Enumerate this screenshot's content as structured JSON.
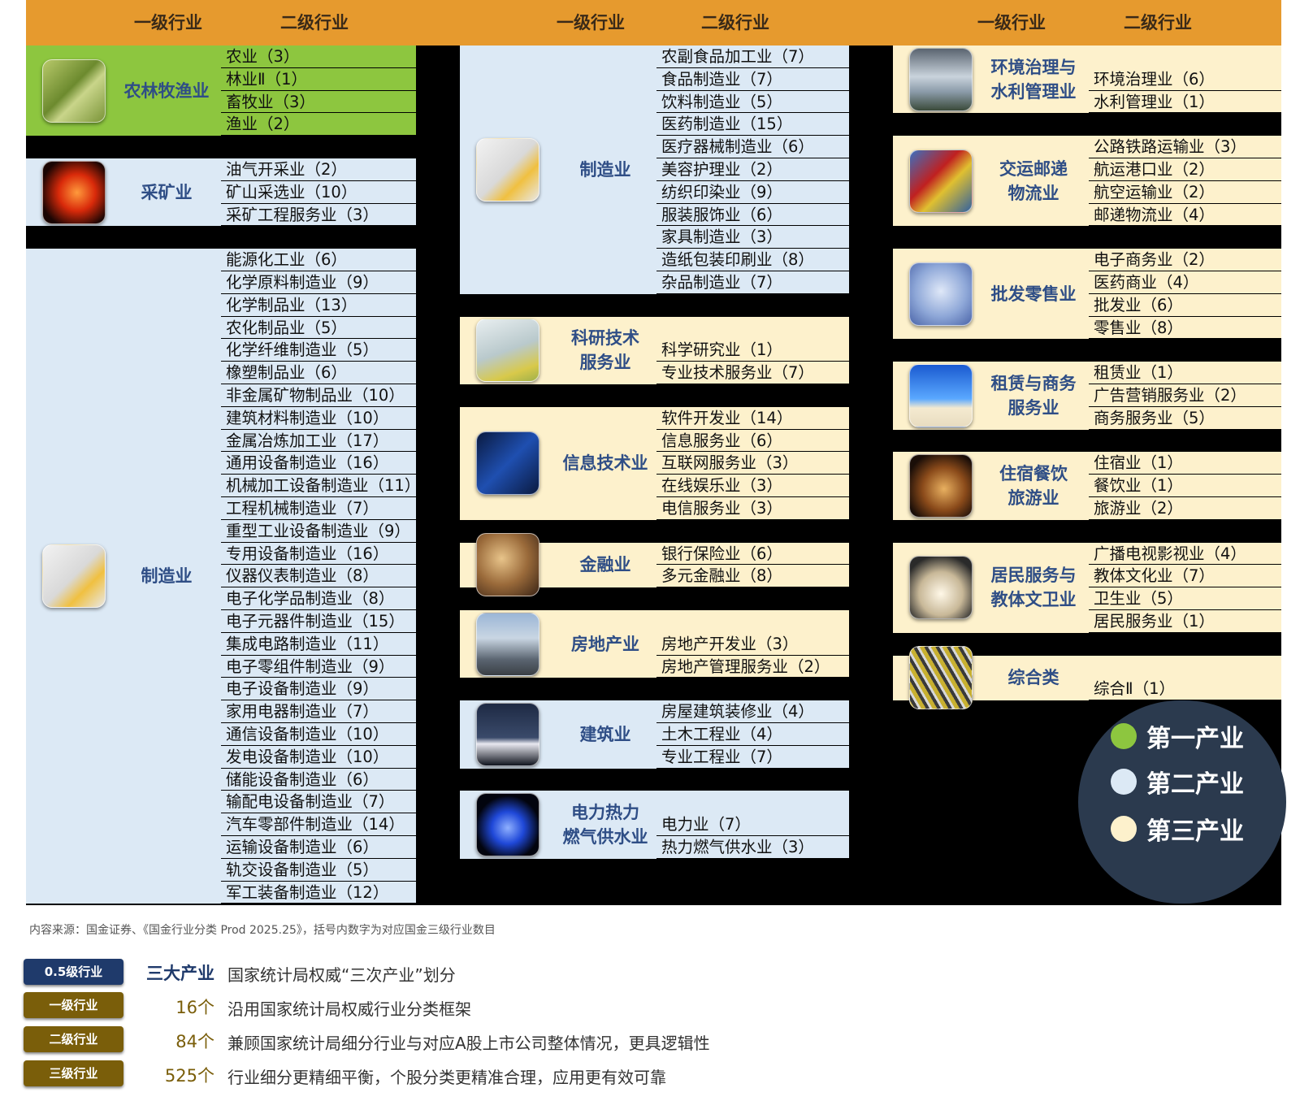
{
  "header": {
    "col1": "一级行业",
    "col2": "二级行业"
  },
  "colors": {
    "primary": "#8DC63F",
    "secondary": "#DCE9F5",
    "tertiary": "#FDF1CC",
    "header": "#E69A2E",
    "badge_navy": "#1F3A6B",
    "badge_gold": "#7A5E0A"
  },
  "columns": [
    {
      "blocks": [
        {
          "name": "农林牧渔业",
          "icon": "field-icon",
          "sector": "primary",
          "subs": [
            "农业（3）",
            "林业Ⅱ（1）",
            "畜牧业（3）",
            "渔业（2）"
          ]
        },
        {
          "name": "采矿业",
          "icon": "molten-metal-icon",
          "sector": "secondary",
          "subs": [
            "油气开采业（2）",
            "矿山采选业（10）",
            "采矿工程服务业（3）"
          ]
        },
        {
          "name": "制造业",
          "icon": "robot-arm-icon",
          "sector": "secondary",
          "subs": [
            "能源化工业（6）",
            "化学原料制造业（9）",
            "化学制品业（13）",
            "农化制品业（5）",
            "化学纤维制造业（5）",
            "橡塑制品业（6）",
            "非金属矿物制品业（10）",
            "建筑材料制造业（10）",
            "金属冶炼加工业（17）",
            "通用设备制造业（16）",
            "机械加工设备制造业（11）",
            "工程机械制造业（7）",
            "重型工业设备制造业（9）",
            "专用设备制造业（16）",
            "仪器仪表制造业（8）",
            "电子化学品制造业（8）",
            "电子元器件制造业（15）",
            "集成电路制造业（11）",
            "电子零组件制造业（9）",
            "电子设备制造业（9）",
            "家用电器制造业（7）",
            "通信设备制造业（10）",
            "发电设备制造业（10）",
            "储能设备制造业（6）",
            "输配电设备制造业（7）",
            "汽车零部件制造业（14）",
            "运输设备制造业（6）",
            "轨交设备制造业（5）",
            "军工装备制造业（12）"
          ]
        }
      ]
    },
    {
      "blocks": [
        {
          "name": "制造业",
          "icon": "robot-arm-icon",
          "sector": "secondary",
          "subs": [
            "农副食品加工业（7）",
            "食品制造业（7）",
            "饮料制造业（5）",
            "医药制造业（15）",
            "医疗器械制造业（6）",
            "美容护理业（2）",
            "纺织印染业（9）",
            "服装服饰业（6）",
            "家具制造业（3）",
            "造纸包装印刷业（8）",
            "杂品制造业（7）"
          ]
        },
        {
          "name": "科研技术\n服务业",
          "icon": "lab-flask-icon",
          "sector": "tertiary",
          "subs": [
            "科学研究业（1）",
            "专业技术服务业（7）"
          ]
        },
        {
          "name": "信息技术业",
          "icon": "binary-code-icon",
          "sector": "tertiary",
          "subs": [
            "软件开发业（14）",
            "信息服务业（6）",
            "互联网服务业（3）",
            "在线娱乐业（3）",
            "电信服务业（3）"
          ]
        },
        {
          "name": "金融业",
          "icon": "coins-icon",
          "sector": "tertiary",
          "subs": [
            "银行保险业（6）",
            "多元金融业（8）"
          ]
        },
        {
          "name": "房地产业",
          "icon": "city-skyline-icon",
          "sector": "tertiary",
          "subs": [
            "房地产开发业（3）",
            "房地产管理服务业（2）"
          ]
        },
        {
          "name": "建筑业",
          "icon": "construction-crane-icon",
          "sector": "secondary",
          "subs": [
            "房屋建筑装修业（4）",
            "土木工程业（4）",
            "专业工程业（7）"
          ]
        },
        {
          "name": "电力热力\n燃气供水业",
          "icon": "gas-flame-icon",
          "sector": "secondary",
          "subs": [
            "电力业（7）",
            "热力燃气供水业（3）"
          ]
        }
      ]
    },
    {
      "blocks": [
        {
          "name": "环境治理与\n水利管理业",
          "icon": "dam-icon",
          "sector": "tertiary",
          "subs": [
            "环境治理业（6）",
            "水利管理业（1）"
          ]
        },
        {
          "name": "交运邮递\n物流业",
          "icon": "container-truck-icon",
          "sector": "tertiary",
          "subs": [
            "公路铁路运输业（3）",
            "航运港口业（2）",
            "航空运输业（2）",
            "邮递物流业（4）"
          ]
        },
        {
          "name": "批发零售业",
          "icon": "shopping-cart-icon",
          "sector": "tertiary",
          "subs": [
            "电子商务业（2）",
            "医药商业（4）",
            "批发业（6）",
            "零售业（8）"
          ]
        },
        {
          "name": "租赁与商务\n服务业",
          "icon": "beach-umbrella-icon",
          "sector": "tertiary",
          "subs": [
            "租赁业（1）",
            "广告营销服务业（2）",
            "商务服务业（5）"
          ]
        },
        {
          "name": "住宿餐饮\n旅游业",
          "icon": "burger-icon",
          "sector": "tertiary",
          "subs": [
            "住宿业（1）",
            "餐饮业（1）",
            "旅游业（2）"
          ]
        },
        {
          "name": "居民服务与\n教体文卫业",
          "icon": "open-book-icon",
          "sector": "tertiary",
          "subs": [
            "广播电视影视业（4）",
            "教体文化业（7）",
            "卫生业（5）",
            "居民服务业（1）"
          ]
        },
        {
          "name": "综合类",
          "icon": "building-facade-icon",
          "sector": "tertiary",
          "subs": [
            "综合Ⅱ（1）"
          ]
        }
      ]
    }
  ],
  "legend": [
    {
      "label": "第一产业",
      "color": "#8DC63F"
    },
    {
      "label": "第二产业",
      "color": "#DCE9F5"
    },
    {
      "label": "第三产业",
      "color": "#FDF1CC"
    }
  ],
  "source": "内容来源：国金证券、《国金行业分类 Prod 2025.25》，括号内数字为对应国金三级行业数目",
  "levels": [
    {
      "badge": "0.5级行业",
      "count": "三大产业",
      "desc": "国家统计局权威“三次产业”划分",
      "badge_color": "#1F3A6B",
      "count_color": "#1F3A6B"
    },
    {
      "badge": "一级行业",
      "count": "16个",
      "desc": "沿用国家统计局权威行业分类框架",
      "badge_color": "#7A5E0A",
      "count_color": "#7A5E0A"
    },
    {
      "badge": "二级行业",
      "count": "84个",
      "desc": "兼顾国家统计局细分行业与对应A股上市公司整体情况，更具逻辑性",
      "badge_color": "#7A5E0A",
      "count_color": "#7A5E0A"
    },
    {
      "badge": "三级行业",
      "count": "525个",
      "desc": "行业细分更精细平衡，个股分类更精准合理，应用更有效可靠",
      "badge_color": "#7A5E0A",
      "count_color": "#7A5E0A"
    }
  ]
}
